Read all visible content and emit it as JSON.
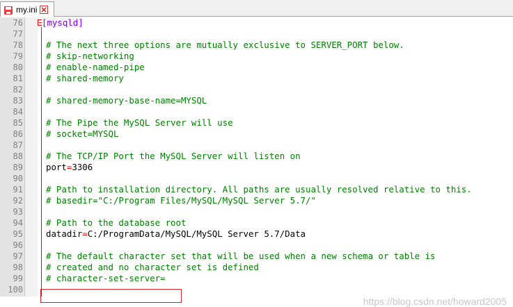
{
  "tab": {
    "filename": "my.ini",
    "close_icon": "close-icon"
  },
  "lines": [
    {
      "num": "76",
      "kind": "section",
      "text": "mysqld"
    },
    {
      "num": "77",
      "kind": "blank",
      "text": ""
    },
    {
      "num": "78",
      "kind": "comment",
      "text": "# The next three options are mutually exclusive to SERVER_PORT below."
    },
    {
      "num": "79",
      "kind": "comment",
      "text": "# skip-networking"
    },
    {
      "num": "80",
      "kind": "comment",
      "text": "# enable-named-pipe"
    },
    {
      "num": "81",
      "kind": "comment",
      "text": "# shared-memory"
    },
    {
      "num": "82",
      "kind": "blank",
      "text": ""
    },
    {
      "num": "83",
      "kind": "comment",
      "text": "# shared-memory-base-name=MYSQL"
    },
    {
      "num": "84",
      "kind": "blank",
      "text": ""
    },
    {
      "num": "85",
      "kind": "comment",
      "text": "# The Pipe the MySQL Server will use"
    },
    {
      "num": "86",
      "kind": "comment",
      "text": "# socket=MYSQL"
    },
    {
      "num": "87",
      "kind": "blank",
      "text": ""
    },
    {
      "num": "88",
      "kind": "comment",
      "text": "# The TCP/IP Port the MySQL Server will listen on"
    },
    {
      "num": "89",
      "kind": "kv",
      "key": "port",
      "value": "3306"
    },
    {
      "num": "90",
      "kind": "blank",
      "text": ""
    },
    {
      "num": "91",
      "kind": "comment",
      "text": "# Path to installation directory. All paths are usually resolved relative to this."
    },
    {
      "num": "92",
      "kind": "comment",
      "text": "# basedir=\"C:/Program Files/MySQL/MySQL Server 5.7/\""
    },
    {
      "num": "93",
      "kind": "blank",
      "text": ""
    },
    {
      "num": "94",
      "kind": "comment",
      "text": "# Path to the database root"
    },
    {
      "num": "95",
      "kind": "kv",
      "key": "datadir",
      "value": "C:/ProgramData/MySQL/MySQL Server 5.7/Data"
    },
    {
      "num": "96",
      "kind": "blank",
      "text": ""
    },
    {
      "num": "97",
      "kind": "comment",
      "text": "# The default character set that will be used when a new schema or table is"
    },
    {
      "num": "98",
      "kind": "comment",
      "text": "# created and no character set is defined"
    },
    {
      "num": "99",
      "kind": "comment",
      "text": "# character-set-server="
    },
    {
      "num": "100",
      "kind": "blank",
      "text": ""
    }
  ],
  "watermark": "https://blog.csdn.net/howard2005",
  "colors": {
    "comment": "#008000",
    "section": "#8000ff",
    "operator": "#ff0000",
    "highlight": "#e02020",
    "line_number": "#808080"
  }
}
